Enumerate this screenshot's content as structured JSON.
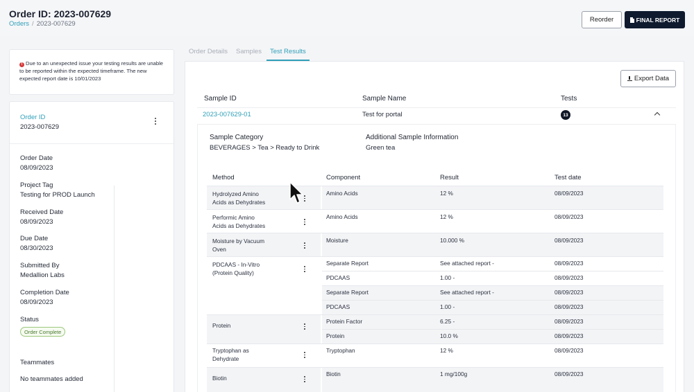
{
  "header": {
    "order_title": "Order ID: 2023-007629",
    "breadcrumb": {
      "root": "Orders",
      "current": "2023-007629"
    },
    "reorder_label": "Reorder",
    "final_report_label": "FINAL REPORT"
  },
  "alert": {
    "message": "Due to an unexpected issue your testing results are unable to be reported within the expected timeframe. The new expected report date is 10/01/2023"
  },
  "order_info": {
    "order_id_label": "Order ID",
    "order_id": "2023-007629",
    "order_date_label": "Order Date",
    "order_date": "08/09/2023",
    "project_tag_label": "Project Tag",
    "project_tag": "Testing for PROD Launch",
    "received_date_label": "Received Date",
    "received_date": "08/09/2023",
    "due_date_label": "Due Date",
    "due_date": "08/30/2023",
    "submitted_by_label": "Submitted By",
    "submitted_by": "Medallion Labs",
    "completion_date_label": "Completion Date",
    "completion_date": "08/09/2023",
    "status_label": "Status",
    "status": "Order Complete",
    "teammates_label": "Teammates",
    "teammates": "No teammates added"
  },
  "tabs": {
    "order_details": "Order Details",
    "samples": "Samples",
    "test_results": "Test Results"
  },
  "results": {
    "export_label": "Export Data",
    "col_sample_id": "Sample ID",
    "col_sample_name": "Sample Name",
    "col_tests": "Tests",
    "sample": {
      "id": "2023-007629-01",
      "name": "Test for portal",
      "tests_count": "13",
      "category_label": "Sample Category",
      "category": "BEVERAGES > Tea > Ready to Drink",
      "additional_label": "Additional Sample Information",
      "additional": "Green tea"
    },
    "table_headers": {
      "method": "Method",
      "component": "Component",
      "result": "Result",
      "test_date": "Test date"
    },
    "methods": [
      {
        "name_line1": "Hydrolyzed Amino",
        "name_line2": "Acids as Dehydrates"
      },
      {
        "name_line1": "Performic Amino",
        "name_line2": "Acids as Dehydrates"
      },
      {
        "name_line1": "Moisture by Vacuum",
        "name_line2": "Oven"
      },
      {
        "name_line1": "PDCAAS - In-Vitro",
        "name_line2": "(Protein Quality)"
      },
      {
        "name_line1": "Protein",
        "name_line2": ""
      },
      {
        "name_line1": "Tryptophan as",
        "name_line2": "Dehydrate"
      },
      {
        "name_line1": "Biotin",
        "name_line2": ""
      }
    ],
    "rows": [
      {
        "component": "Amino Acids",
        "result": "12 %",
        "date": "08/09/2023"
      },
      {
        "component": "Amino Acids",
        "result": "12 %",
        "date": "08/09/2023"
      },
      {
        "component": "Moisture",
        "result": "10.000 %",
        "date": "08/09/2023"
      },
      {
        "component": "Separate Report",
        "result": "See attached report -",
        "date": "08/09/2023"
      },
      {
        "component": "PDCAAS",
        "result": "1.00 -",
        "date": "08/09/2023"
      },
      {
        "component": "Separate Report",
        "result": "See attached report -",
        "date": "08/09/2023"
      },
      {
        "component": "PDCAAS",
        "result": "1.00 -",
        "date": "08/09/2023"
      },
      {
        "component": "Protein Factor",
        "result": "6.25 -",
        "date": "08/09/2023"
      },
      {
        "component": "Protein",
        "result": "10.0 %",
        "date": "08/09/2023"
      },
      {
        "component": "Tryptophan",
        "result": "12 %",
        "date": "08/09/2023"
      },
      {
        "component": "Biotin",
        "result": "1 mg/100g",
        "date": "08/09/2023"
      }
    ]
  },
  "colors": {
    "accent": "#2f9fb8",
    "primary_dark": "#0f1a2e",
    "status_green": "#4a7a2e",
    "alert_red": "#d33b3b"
  },
  "icons": [
    "file-icon",
    "alert-icon",
    "kebab-icon",
    "download-icon",
    "chevron-up-icon",
    "mouse-cursor-icon"
  ]
}
